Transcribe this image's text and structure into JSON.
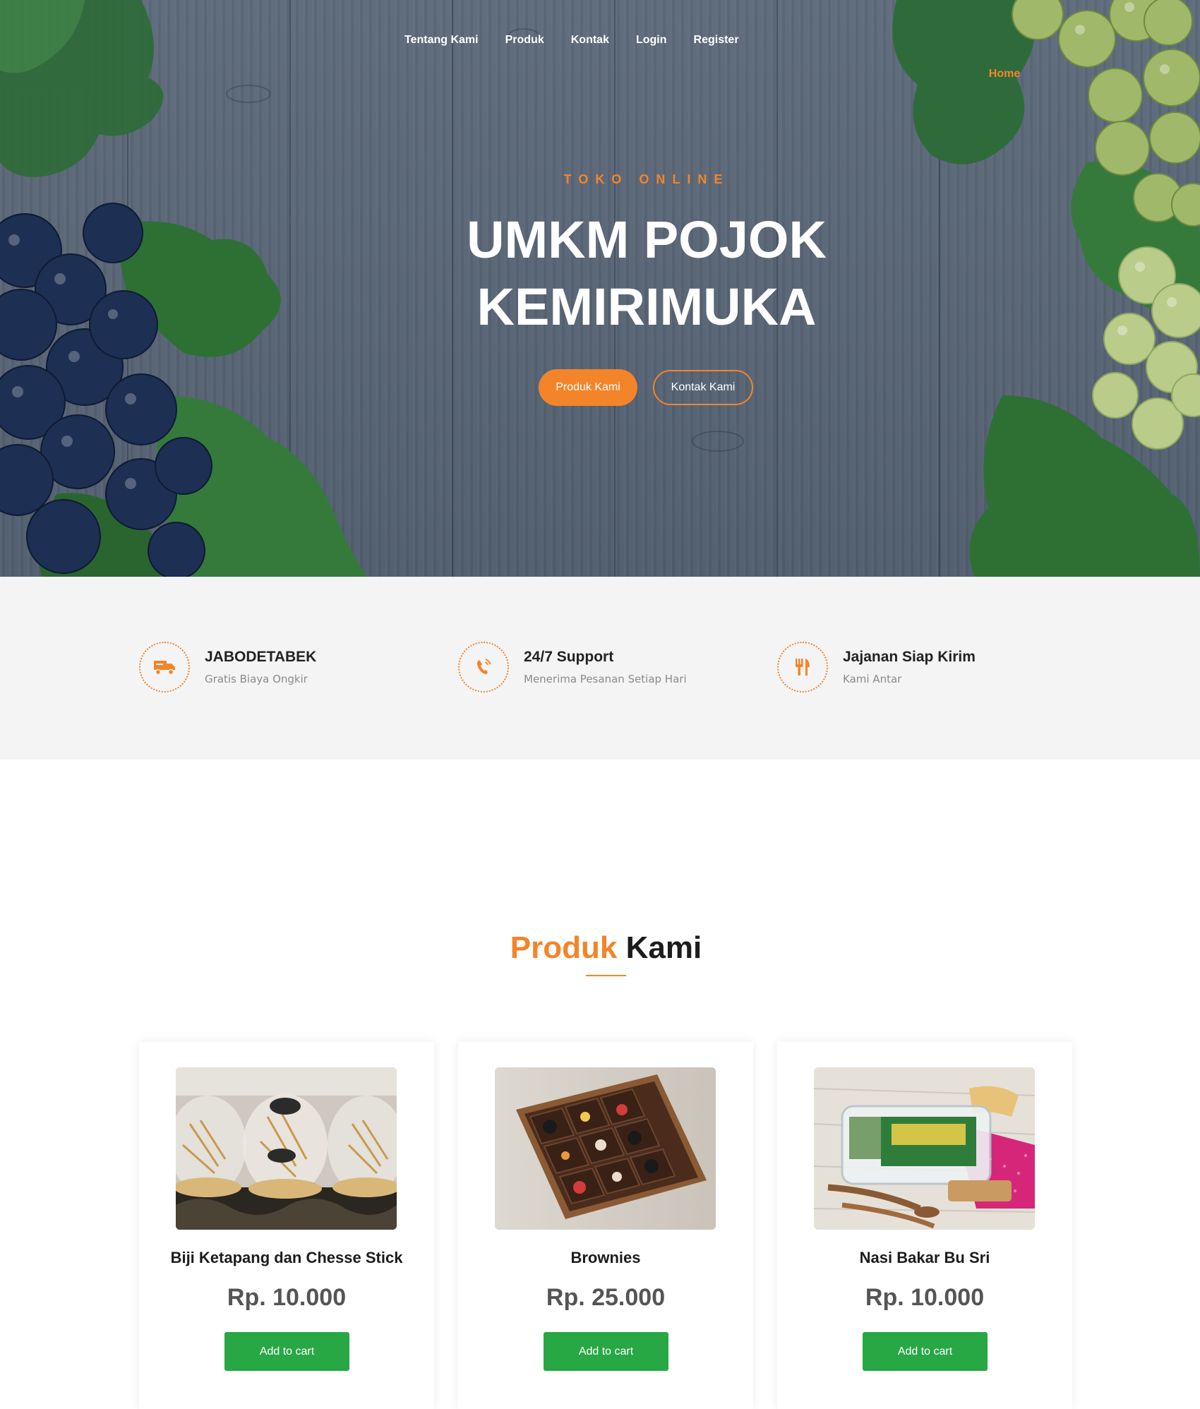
{
  "nav": {
    "items": [
      "Home",
      "Tentang Kami",
      "Produk",
      "Kontak",
      "Login",
      "Register"
    ],
    "active": "Home"
  },
  "hero": {
    "tagline": "TOKO ONLINE",
    "title_line1": "UMKM POJOK",
    "title_line2": "KEMIRIMUKA",
    "primary_button": "Produk Kami",
    "secondary_button": "Kontak Kami"
  },
  "features": [
    {
      "icon": "truck-icon",
      "title": "JABODETABEK",
      "subtitle": "Gratis Biaya Ongkir"
    },
    {
      "icon": "phone-icon",
      "title": "24/7 Support",
      "subtitle": "Menerima Pesanan Setiap Hari"
    },
    {
      "icon": "utensils-icon",
      "title": "Jajanan Siap Kirim",
      "subtitle": "Kami Antar"
    }
  ],
  "products_section": {
    "title_accent": "Produk",
    "title_rest": "Kami"
  },
  "products": [
    {
      "name": "Biji Ketapang dan Chesse Stick",
      "price": "Rp. 10.000",
      "button": "Add to cart"
    },
    {
      "name": "Brownies",
      "price": "Rp. 25.000",
      "button": "Add to cart"
    },
    {
      "name": "Nasi Bakar Bu Sri",
      "price": "Rp. 10.000",
      "button": "Add to cart"
    }
  ],
  "colors": {
    "accent": "#f4842a",
    "cart_button": "#28a745",
    "features_bg": "#f4f4f4"
  }
}
